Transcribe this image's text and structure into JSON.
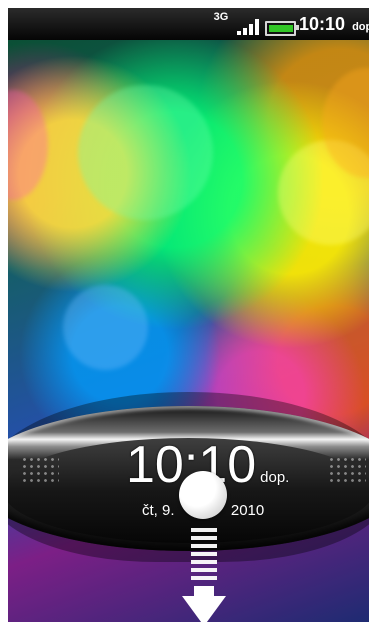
{
  "status_bar": {
    "network": "3G",
    "time": "10:10",
    "period": "dop."
  },
  "lock_screen": {
    "time": "10:10",
    "period": "dop.",
    "date_prefix": "čt, 9.",
    "date_suffix": "2010"
  },
  "unlock": {
    "direction": "down"
  }
}
